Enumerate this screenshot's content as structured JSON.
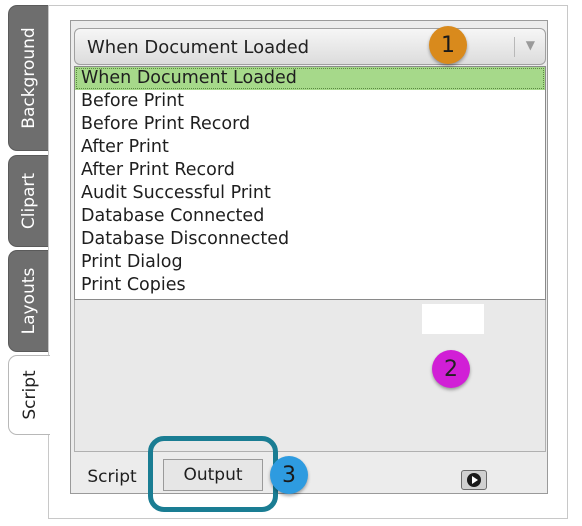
{
  "side_tabs": [
    {
      "label": "Background"
    },
    {
      "label": "Clipart"
    },
    {
      "label": "Layouts"
    },
    {
      "label": "Script"
    }
  ],
  "event_combo": {
    "selected": "When Document Loaded"
  },
  "event_list": [
    "When Document Loaded",
    "Before Print",
    "Before Print Record",
    "After Print",
    "After Print Record",
    "Audit Successful Print",
    "Database Connected",
    "Database Disconnected",
    "Print Dialog",
    "Print Copies"
  ],
  "callouts": {
    "one": "1",
    "two": "2",
    "three": "3"
  },
  "bottom_tabs": {
    "script": "Script",
    "output": "Output"
  },
  "colors": {
    "selected_row": "#a6d98a",
    "callout_1": "#d98a1c",
    "callout_2": "#d11fd6",
    "callout_3": "#2e9be0",
    "highlight_frame": "#1a7d93"
  },
  "icons": {
    "run": "play-circle-icon",
    "dropdown": "chevron-down-icon"
  }
}
